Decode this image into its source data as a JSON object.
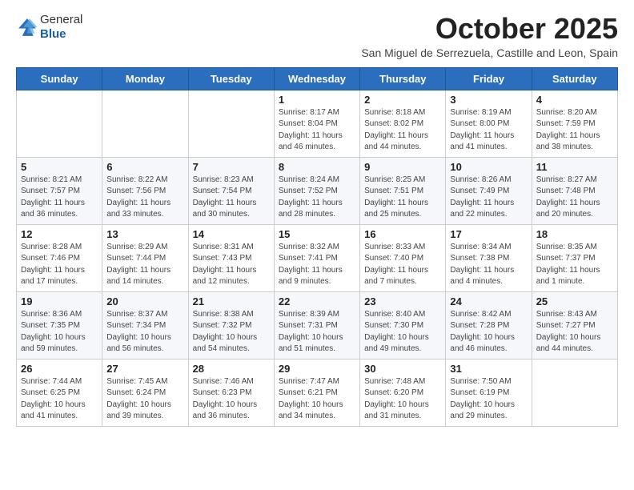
{
  "header": {
    "logo_general": "General",
    "logo_blue": "Blue",
    "title": "October 2025",
    "subtitle": "San Miguel de Serrezuela, Castille and Leon, Spain"
  },
  "weekdays": [
    "Sunday",
    "Monday",
    "Tuesday",
    "Wednesday",
    "Thursday",
    "Friday",
    "Saturday"
  ],
  "weeks": [
    [
      {
        "day": "",
        "info": ""
      },
      {
        "day": "",
        "info": ""
      },
      {
        "day": "",
        "info": ""
      },
      {
        "day": "1",
        "info": "Sunrise: 8:17 AM\nSunset: 8:04 PM\nDaylight: 11 hours\nand 46 minutes."
      },
      {
        "day": "2",
        "info": "Sunrise: 8:18 AM\nSunset: 8:02 PM\nDaylight: 11 hours\nand 44 minutes."
      },
      {
        "day": "3",
        "info": "Sunrise: 8:19 AM\nSunset: 8:00 PM\nDaylight: 11 hours\nand 41 minutes."
      },
      {
        "day": "4",
        "info": "Sunrise: 8:20 AM\nSunset: 7:59 PM\nDaylight: 11 hours\nand 38 minutes."
      }
    ],
    [
      {
        "day": "5",
        "info": "Sunrise: 8:21 AM\nSunset: 7:57 PM\nDaylight: 11 hours\nand 36 minutes."
      },
      {
        "day": "6",
        "info": "Sunrise: 8:22 AM\nSunset: 7:56 PM\nDaylight: 11 hours\nand 33 minutes."
      },
      {
        "day": "7",
        "info": "Sunrise: 8:23 AM\nSunset: 7:54 PM\nDaylight: 11 hours\nand 30 minutes."
      },
      {
        "day": "8",
        "info": "Sunrise: 8:24 AM\nSunset: 7:52 PM\nDaylight: 11 hours\nand 28 minutes."
      },
      {
        "day": "9",
        "info": "Sunrise: 8:25 AM\nSunset: 7:51 PM\nDaylight: 11 hours\nand 25 minutes."
      },
      {
        "day": "10",
        "info": "Sunrise: 8:26 AM\nSunset: 7:49 PM\nDaylight: 11 hours\nand 22 minutes."
      },
      {
        "day": "11",
        "info": "Sunrise: 8:27 AM\nSunset: 7:48 PM\nDaylight: 11 hours\nand 20 minutes."
      }
    ],
    [
      {
        "day": "12",
        "info": "Sunrise: 8:28 AM\nSunset: 7:46 PM\nDaylight: 11 hours\nand 17 minutes."
      },
      {
        "day": "13",
        "info": "Sunrise: 8:29 AM\nSunset: 7:44 PM\nDaylight: 11 hours\nand 14 minutes."
      },
      {
        "day": "14",
        "info": "Sunrise: 8:31 AM\nSunset: 7:43 PM\nDaylight: 11 hours\nand 12 minutes."
      },
      {
        "day": "15",
        "info": "Sunrise: 8:32 AM\nSunset: 7:41 PM\nDaylight: 11 hours\nand 9 minutes."
      },
      {
        "day": "16",
        "info": "Sunrise: 8:33 AM\nSunset: 7:40 PM\nDaylight: 11 hours\nand 7 minutes."
      },
      {
        "day": "17",
        "info": "Sunrise: 8:34 AM\nSunset: 7:38 PM\nDaylight: 11 hours\nand 4 minutes."
      },
      {
        "day": "18",
        "info": "Sunrise: 8:35 AM\nSunset: 7:37 PM\nDaylight: 11 hours\nand 1 minute."
      }
    ],
    [
      {
        "day": "19",
        "info": "Sunrise: 8:36 AM\nSunset: 7:35 PM\nDaylight: 10 hours\nand 59 minutes."
      },
      {
        "day": "20",
        "info": "Sunrise: 8:37 AM\nSunset: 7:34 PM\nDaylight: 10 hours\nand 56 minutes."
      },
      {
        "day": "21",
        "info": "Sunrise: 8:38 AM\nSunset: 7:32 PM\nDaylight: 10 hours\nand 54 minutes."
      },
      {
        "day": "22",
        "info": "Sunrise: 8:39 AM\nSunset: 7:31 PM\nDaylight: 10 hours\nand 51 minutes."
      },
      {
        "day": "23",
        "info": "Sunrise: 8:40 AM\nSunset: 7:30 PM\nDaylight: 10 hours\nand 49 minutes."
      },
      {
        "day": "24",
        "info": "Sunrise: 8:42 AM\nSunset: 7:28 PM\nDaylight: 10 hours\nand 46 minutes."
      },
      {
        "day": "25",
        "info": "Sunrise: 8:43 AM\nSunset: 7:27 PM\nDaylight: 10 hours\nand 44 minutes."
      }
    ],
    [
      {
        "day": "26",
        "info": "Sunrise: 7:44 AM\nSunset: 6:25 PM\nDaylight: 10 hours\nand 41 minutes."
      },
      {
        "day": "27",
        "info": "Sunrise: 7:45 AM\nSunset: 6:24 PM\nDaylight: 10 hours\nand 39 minutes."
      },
      {
        "day": "28",
        "info": "Sunrise: 7:46 AM\nSunset: 6:23 PM\nDaylight: 10 hours\nand 36 minutes."
      },
      {
        "day": "29",
        "info": "Sunrise: 7:47 AM\nSunset: 6:21 PM\nDaylight: 10 hours\nand 34 minutes."
      },
      {
        "day": "30",
        "info": "Sunrise: 7:48 AM\nSunset: 6:20 PM\nDaylight: 10 hours\nand 31 minutes."
      },
      {
        "day": "31",
        "info": "Sunrise: 7:50 AM\nSunset: 6:19 PM\nDaylight: 10 hours\nand 29 minutes."
      },
      {
        "day": "",
        "info": ""
      }
    ]
  ]
}
